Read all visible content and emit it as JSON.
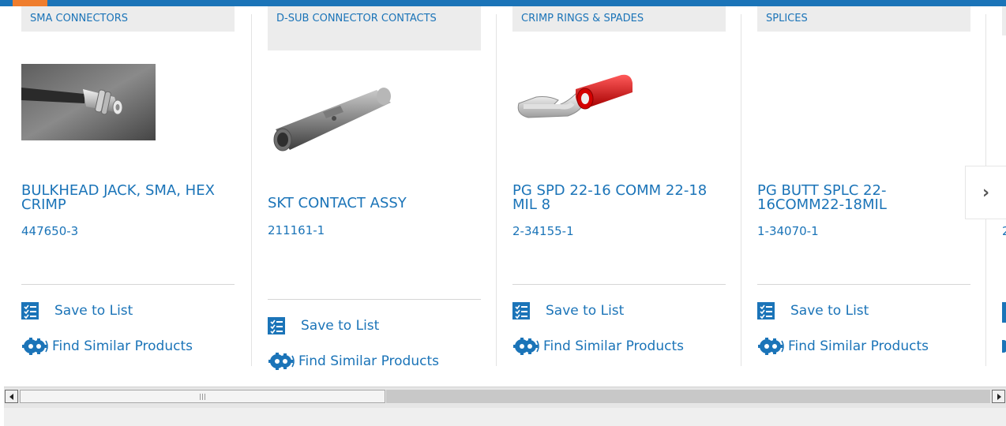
{
  "products": [
    {
      "category": "SMA CONNECTORS",
      "title": "BULKHEAD JACK, SMA, HEX CRIMP",
      "part_number": "447650-3",
      "save_label": "Save to List",
      "similar_label": "Find Similar Products"
    },
    {
      "category": "D-SUB CONNECTOR CONTACTS",
      "title": "SKT CONTACT ASSY",
      "part_number": "211161-1",
      "save_label": "Save to List",
      "similar_label": "Find Similar Products"
    },
    {
      "category": "CRIMP RINGS & SPADES",
      "title": "PG SPD 22-16 COMM 22-18 MIL 8",
      "part_number": "2-34155-1",
      "save_label": "Save to List",
      "similar_label": "Find Similar Products"
    },
    {
      "category": "SPLICES",
      "title": "PG BUTT SPLC 22-16COMM22-18MIL",
      "part_number": "1-34070-1",
      "save_label": "Save to List",
      "similar_label": "Find Similar Products"
    }
  ],
  "partial_card": {
    "part_number_prefix": "2"
  },
  "carousel": {
    "next_label": "›"
  },
  "colors": {
    "brand_blue": "#1b74b8",
    "accent_orange": "#ef7d2d"
  },
  "icons": [
    "checklist-icon",
    "gears-icon",
    "chevron-right-icon",
    "scroll-left-arrow-icon",
    "scroll-right-arrow-icon"
  ]
}
